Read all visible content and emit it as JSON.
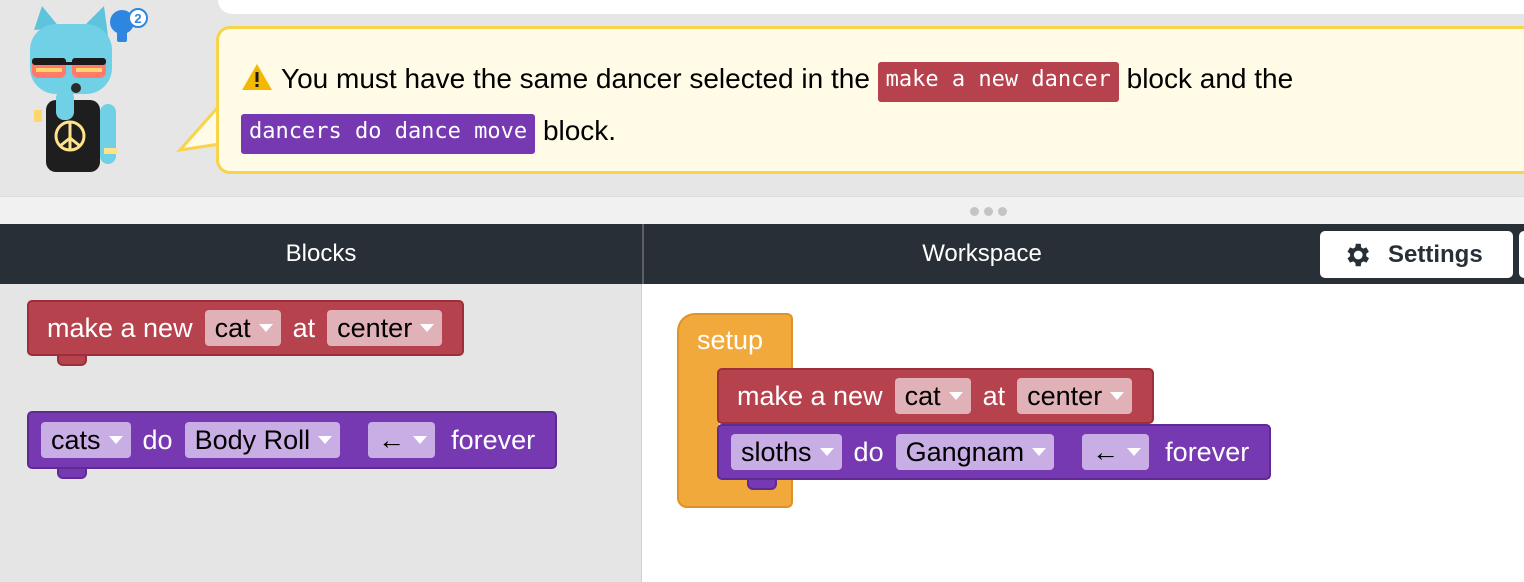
{
  "instructions": {
    "hint_count": "2",
    "message_part1": "You must have the same dancer selected in the",
    "code_make_new_dancer": "make a new dancer",
    "message_part2": "block and the",
    "code_dancers_do_move": "dancers do dance move",
    "message_part3": "block."
  },
  "header": {
    "blocks_label": "Blocks",
    "workspace_label": "Workspace",
    "settings_label": "Settings"
  },
  "toolbox": {
    "make_block": {
      "prefix": "make a new",
      "dancer_value": "cat",
      "at_label": "at",
      "position_value": "center"
    },
    "dance_block": {
      "group_value": "cats",
      "do_label": "do",
      "move_value": "Body Roll",
      "direction_value": "←",
      "suffix": "forever"
    }
  },
  "workspace": {
    "setup_label": "setup",
    "make_block": {
      "prefix": "make a new",
      "dancer_value": "cat",
      "at_label": "at",
      "position_value": "center"
    },
    "dance_block": {
      "group_value": "sloths",
      "do_label": "do",
      "move_value": "Gangnam",
      "direction_value": "←",
      "suffix": "forever"
    }
  },
  "colors": {
    "create_block": "#b5424d",
    "dance_block": "#7639b2",
    "setup_block": "#f1a93b",
    "header_bar": "#292f36",
    "bubble_bg": "#fffbe6",
    "bubble_border": "#f7d44a"
  },
  "icons": {
    "warning": "warning-icon",
    "settings": "gear-icon",
    "hint": "lightbulb-icon"
  }
}
